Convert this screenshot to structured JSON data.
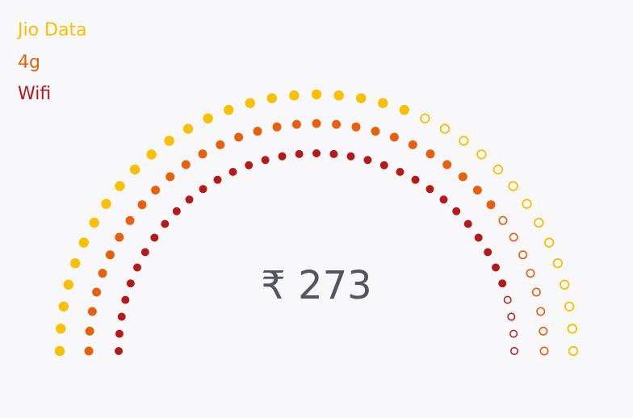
{
  "chart_data": {
    "type": "radial-dot-gauge",
    "center_label": "₹ 273",
    "series": [
      {
        "name": "Jio Data",
        "color": "#f8c000",
        "filled_fraction": 0.625
      },
      {
        "name": "4g",
        "color": "#e8600c",
        "filled_fraction": 0.78
      },
      {
        "name": "Wifi",
        "color": "#b51a1a",
        "filled_fraction": 0.9
      }
    ]
  }
}
